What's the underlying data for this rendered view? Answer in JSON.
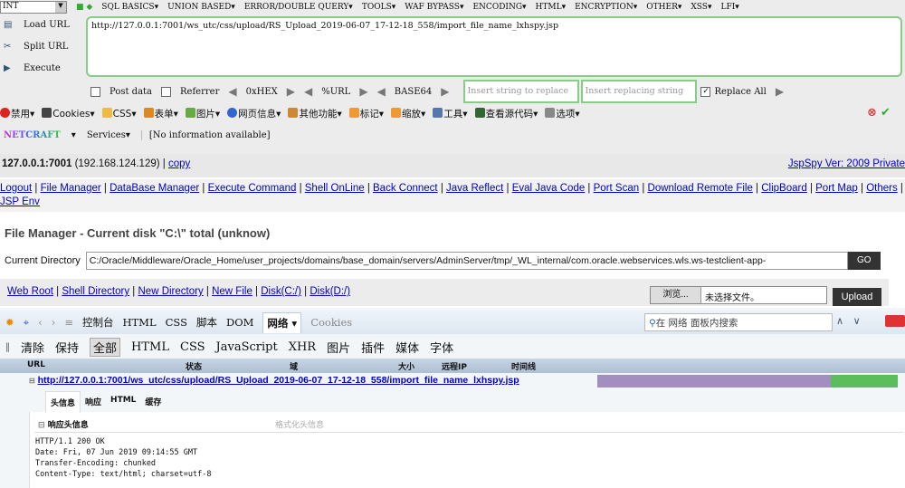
{
  "hackbar": {
    "select": "INT",
    "menus": [
      "SQL BASICS▾",
      "UNION BASED▾",
      "ERROR/DOUBLE QUERY▾",
      "TOOLS▾",
      "WAF BYPASS▾",
      "ENCODING▾",
      "HTML▾",
      "ENCRYPTION▾",
      "OTHER▾",
      "XSS▾",
      "LFI▾"
    ],
    "load_url": "Load URL",
    "split_url": "Split URL",
    "execute": "Execute",
    "url": "http://127.0.0.1:7001/ws_utc/css/upload/RS_Upload_2019-06-07_17-12-18_558/import_file_name_lxhspy.jsp",
    "post_data": "Post data",
    "referrer": "Referrer",
    "hex": "0xHEX",
    "urlenc": "%URL",
    "base64": "BASE64",
    "insert_placeholder": "Insert string to replace",
    "replacing_placeholder": "Insert replacing string",
    "replace_all": "Replace All"
  },
  "webdev": {
    "items": [
      "禁用▾",
      "Cookies▾",
      "CSS▾",
      "表单▾",
      "图片▾",
      "网页信息▾",
      "其他功能▾",
      "标记▾",
      "缩放▾",
      "工具▾",
      "查看源代码▾",
      "选项▾"
    ]
  },
  "netcraft": {
    "logo": "NETCRAFT",
    "services": "Services▾",
    "info": "[No information available]"
  },
  "page": {
    "host": "127.0.0.1:7001",
    "ip": "(192.168.124.129)",
    "copy": "copy",
    "version": "JspSpy Ver: 2009 Private",
    "nav": [
      "Logout",
      "File Manager",
      "DataBase Manager",
      "Execute Command",
      "Shell OnLine",
      "Back Connect",
      "Java Reflect",
      "Eval Java Code",
      "Port Scan",
      "Download Remote File",
      "ClipBoard",
      "Port Map",
      "Others",
      "JSP Env"
    ],
    "title": "File Manager - Current disk \"C:\\\" total (unknow)",
    "cur_dir_label": "Current Directory",
    "cur_dir": "C:/Oracle/Middleware/Oracle_Home/user_projects/domains/base_domain/servers/AdminServer/tmp/_WL_internal/com.oracle.webservices.wls.ws-testclient-app-",
    "go": "GO",
    "links": [
      "Web Root",
      "Shell Directory",
      "New Directory",
      "New File",
      "Disk(C:/)",
      "Disk(D:/)"
    ],
    "browse": "浏览...",
    "no_file": "未选择文件。",
    "upload": "Upload"
  },
  "firebug": {
    "tabs": [
      "控制台",
      "HTML",
      "CSS",
      "脚本",
      "DOM",
      "网络 ▾",
      "Cookies"
    ],
    "search": "在 网络 面板内搜索",
    "filters": [
      "清除",
      "保持",
      "全部",
      "HTML",
      "CSS",
      "JavaScript",
      "XHR",
      "图片",
      "插件",
      "媒体",
      "字体"
    ],
    "columns": [
      "URL",
      "状态",
      "域",
      "大小",
      "远程IP",
      "时间线"
    ],
    "request_url": "http://127.0.0.1:7001/ws_utc/css/upload/RS_Upload_2019-06-07_17-12-18_558/import_file_name_lxhspy.jsp",
    "detail_tabs": [
      "头信息",
      "响应",
      "HTML",
      "缓存"
    ],
    "resp_headers": "响应头信息",
    "format_headers": "格式化头信息",
    "headers": [
      "HTTP/1.1 200 OK",
      "Date: Fri, 07 Jun 2019 09:14:55 GMT",
      "Transfer-Encoding: chunked",
      "Content-Type: text/html; charset=utf-8"
    ]
  }
}
